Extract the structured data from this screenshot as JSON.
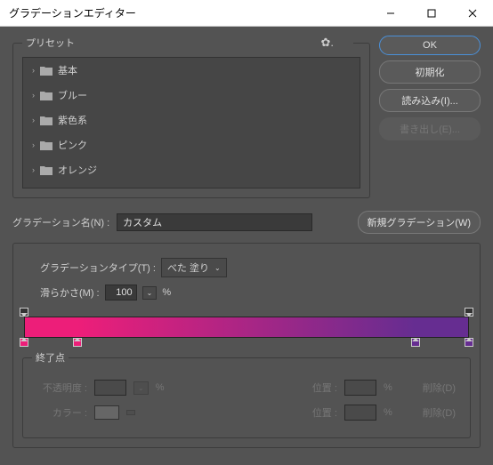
{
  "window": {
    "title": "グラデーションエディター"
  },
  "buttons": {
    "ok": "OK",
    "reset": "初期化",
    "load": "読み込み(I)...",
    "export": "書き出し(E)..."
  },
  "presets": {
    "legend": "プリセット",
    "items": [
      {
        "label": "基本"
      },
      {
        "label": "ブルー"
      },
      {
        "label": "紫色系"
      },
      {
        "label": "ピンク"
      },
      {
        "label": "オレンジ"
      }
    ]
  },
  "name": {
    "label": "グラデーション名(N) :",
    "value": "カスタム"
  },
  "newGradient": "新規グラデーション(W)",
  "type": {
    "label": "グラデーションタイプ(T) :",
    "value": "べた 塗り"
  },
  "smooth": {
    "label": "滑らかさ(M) :",
    "value": "100",
    "unit": "%"
  },
  "gradient": {
    "opacityStops": [
      {
        "pos": 0,
        "color": "#333"
      },
      {
        "pos": 100,
        "color": "#333"
      }
    ],
    "colorStops": [
      {
        "pos": 0,
        "color": "#ed1e79"
      },
      {
        "pos": 12,
        "color": "#ed1e79"
      },
      {
        "pos": 88,
        "color": "#662d91"
      },
      {
        "pos": 100,
        "color": "#662d91"
      }
    ]
  },
  "endpoints": {
    "legend": "終了点",
    "opacityLabel": "不透明度 :",
    "positionLabel": "位置 :",
    "colorLabel": "カラー :",
    "deleteLabel": "削除(D)",
    "percent": "%"
  }
}
